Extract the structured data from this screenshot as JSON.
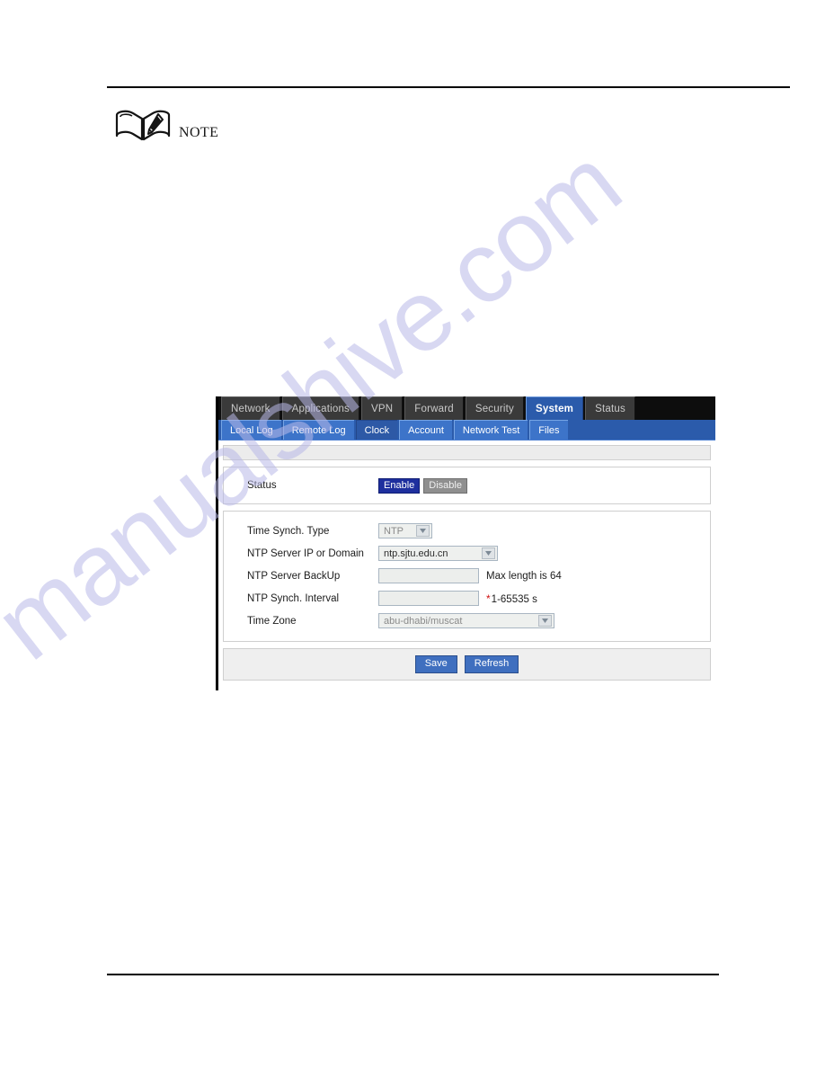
{
  "note": {
    "label": "NOTE",
    "icon": "open-book-with-pen-icon"
  },
  "watermark": {
    "text": "manualshive.com"
  },
  "router_ui": {
    "main_tabs": [
      {
        "label": "Network",
        "active": false
      },
      {
        "label": "Applications",
        "active": false
      },
      {
        "label": "VPN",
        "active": false
      },
      {
        "label": "Forward",
        "active": false
      },
      {
        "label": "Security",
        "active": false
      },
      {
        "label": "System",
        "active": true
      },
      {
        "label": "Status",
        "active": false
      }
    ],
    "sub_tabs": [
      {
        "label": "Local Log",
        "active": false
      },
      {
        "label": "Remote Log",
        "active": false
      },
      {
        "label": "Clock",
        "active": true
      },
      {
        "label": "Account",
        "active": false
      },
      {
        "label": "Network Test",
        "active": false
      },
      {
        "label": "Files",
        "active": false
      }
    ],
    "status_panel": {
      "label": "Status",
      "enable_label": "Enable",
      "disable_label": "Disable",
      "selected": "Enable"
    },
    "settings": {
      "time_sync_type": {
        "label": "Time Synch. Type",
        "value": "NTP"
      },
      "ntp_server": {
        "label": "NTP Server IP or Domain",
        "value": "ntp.sjtu.edu.cn"
      },
      "ntp_server_backup": {
        "label": "NTP Server BackUp",
        "value": "",
        "placeholder": "",
        "hint": "Max length is 64"
      },
      "ntp_sync_interval": {
        "label": "NTP Synch. Interval",
        "value": "",
        "placeholder": "",
        "required_mark": "*",
        "hint": "1-65535 s"
      },
      "time_zone": {
        "label": "Time Zone",
        "value": "abu-dhabi/muscat"
      }
    },
    "buttons": {
      "save_label": "Save",
      "refresh_label": "Refresh"
    },
    "colors": {
      "nav_active": "#2b5bab",
      "sub_nav": "#2b5bab",
      "nav_bg": "#0d0d0d",
      "button": "#3f6fbf",
      "enable_on": "#1e2f9e",
      "disable_off": "#8f8f8f",
      "required": "#d01010"
    }
  }
}
